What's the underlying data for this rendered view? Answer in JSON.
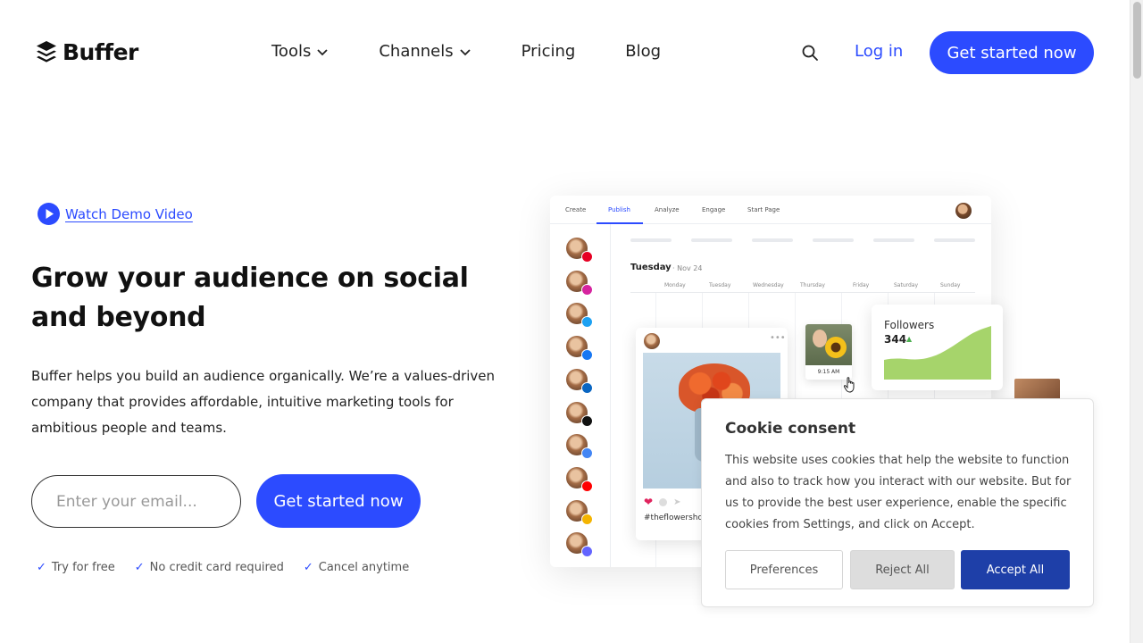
{
  "brand": {
    "name": "Buffer",
    "accent": "#2c4bff"
  },
  "nav": {
    "items": [
      {
        "label": "Tools",
        "dropdown": true
      },
      {
        "label": "Channels",
        "dropdown": true
      },
      {
        "label": "Pricing",
        "dropdown": false
      },
      {
        "label": "Blog",
        "dropdown": false
      }
    ],
    "login": "Log in",
    "cta": "Get started now"
  },
  "hero": {
    "demo_link": "Watch Demo Video",
    "headline": "Grow your audience on social and beyond",
    "description": "Buffer helps you build an audience organically. We’re a values-driven company that provides affordable, intuitive marketing tools for ambitious people and teams.",
    "email_placeholder": "Enter your email...",
    "cta": "Get started now",
    "perks": [
      "Try for free",
      "No credit card required",
      "Cancel anytime"
    ]
  },
  "mock": {
    "tabs": [
      "Create",
      "Publish",
      "Analyze",
      "Engage",
      "Start Page"
    ],
    "active_tab": "Publish",
    "day": "Tuesday",
    "date": "Nov 24",
    "weekdays": [
      "Monday",
      "Tuesday",
      "Wednesday",
      "Thursday",
      "Friday",
      "Saturday",
      "Sunday"
    ],
    "channels": [
      {
        "network": "pinterest",
        "color": "#e60023"
      },
      {
        "network": "instagram",
        "color": "#d6249f"
      },
      {
        "network": "twitter",
        "color": "#1da1f2"
      },
      {
        "network": "facebook",
        "color": "#1877f2"
      },
      {
        "network": "linkedin",
        "color": "#0a66c2"
      },
      {
        "network": "tiktok",
        "color": "#111111"
      },
      {
        "network": "google-business",
        "color": "#4285f4"
      },
      {
        "network": "youtube",
        "color": "#ff0000"
      },
      {
        "network": "start-page",
        "color": "#f4b400"
      },
      {
        "network": "mastodon",
        "color": "#6364ff"
      }
    ],
    "post_tag": "#theflowershop",
    "scheduled_time": "9:15 AM",
    "followers_label": "Followers",
    "followers_count": "344"
  },
  "cookie": {
    "title": "Cookie consent",
    "text": "This website uses cookies that help the website to function and also to track how you interact with our website. But for us to provide the best user experience, enable the specific cookies from Settings, and click on Accept.",
    "preferences": "Preferences",
    "reject": "Reject All",
    "accept": "Accept All"
  }
}
